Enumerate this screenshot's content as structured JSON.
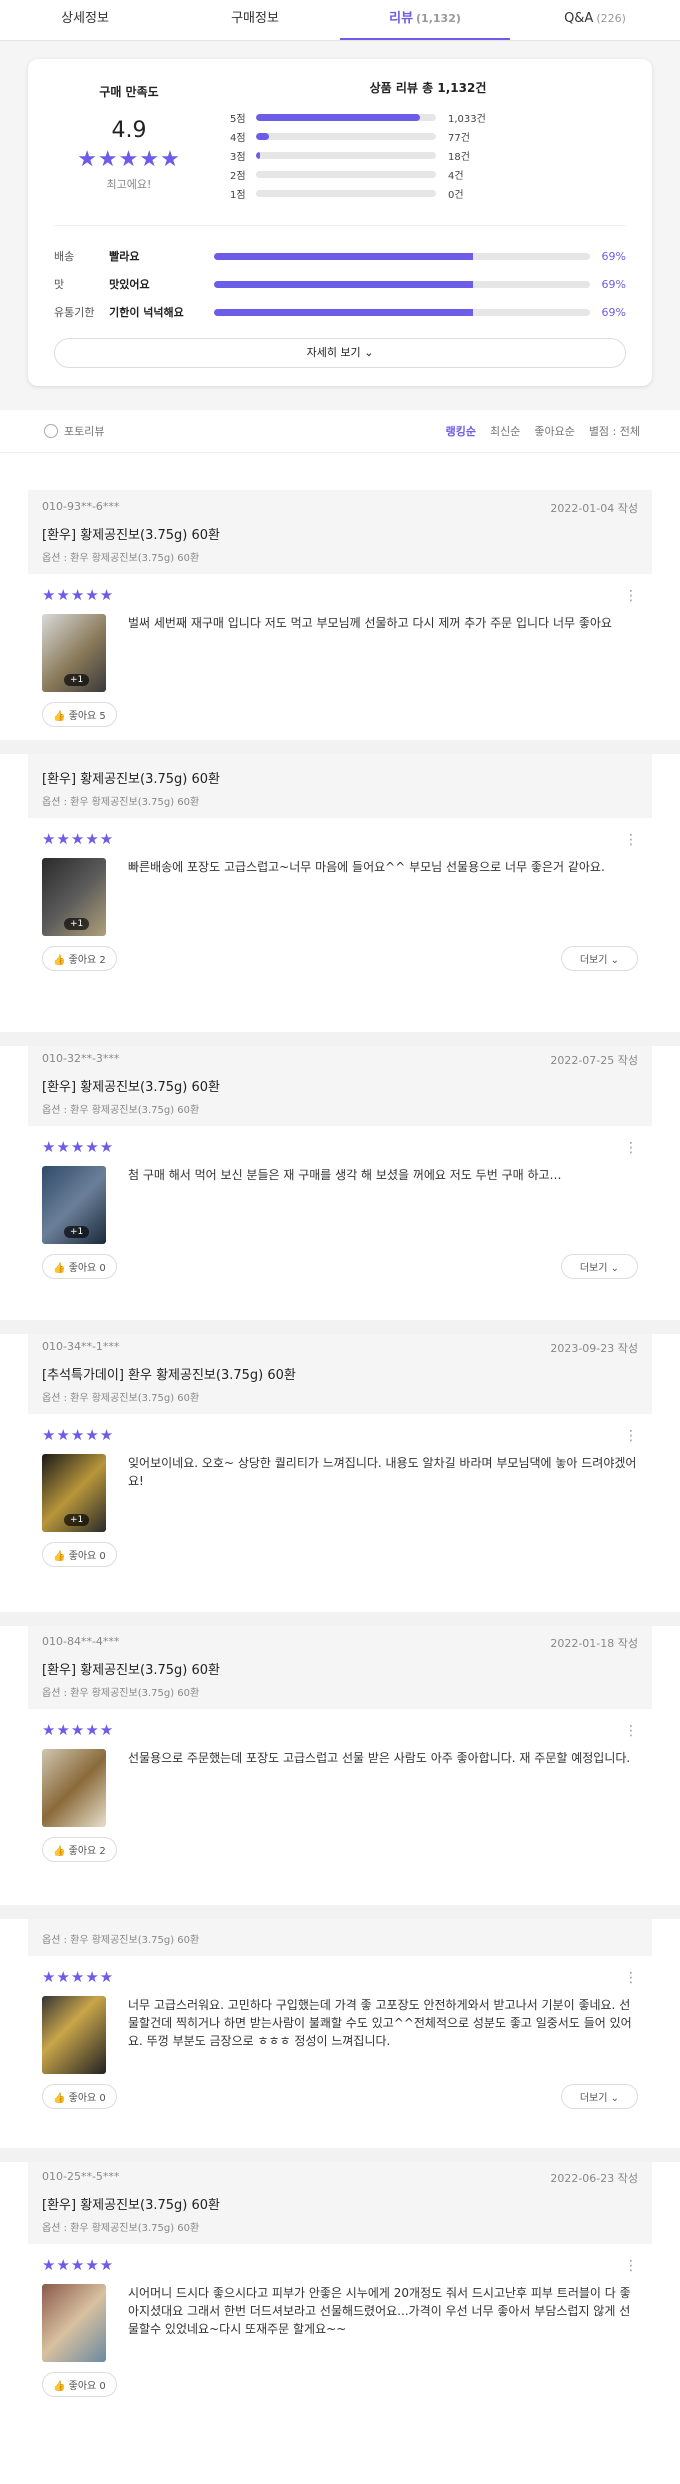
{
  "tabs": [
    {
      "label": "상세정보",
      "count": ""
    },
    {
      "label": "구매정보",
      "count": ""
    },
    {
      "label": "리뷰",
      "count": "(1,132)"
    },
    {
      "label": "Q&A",
      "count": "(226)"
    }
  ],
  "summary": {
    "sat_title": "구매 만족도",
    "score": "4.9",
    "stars": "★★★★★",
    "sat_sub": "최고에요!",
    "dist_title": "상품 리뷰 총 1,132건",
    "dist": [
      {
        "label": "5점",
        "count": "1,033건",
        "ratio": 0.91
      },
      {
        "label": "4점",
        "count": "77건",
        "ratio": 0.07
      },
      {
        "label": "3점",
        "count": "18건",
        "ratio": 0.02
      },
      {
        "label": "2점",
        "count": "4건",
        "ratio": 0.0
      },
      {
        "label": "1점",
        "count": "0건",
        "ratio": 0.0
      }
    ],
    "attrs": [
      {
        "key": "배송",
        "value": "빨라요",
        "pct": "69%",
        "ratio": 0.69
      },
      {
        "key": "맛",
        "value": "맛있어요",
        "pct": "69%",
        "ratio": 0.69
      },
      {
        "key": "유통기한",
        "value": "기한이 넉넉해요",
        "pct": "69%",
        "ratio": 0.69
      }
    ],
    "more_label": "자세히 보기"
  },
  "filter": {
    "photo_label": "포토리뷰",
    "sorts": [
      "랭킹순",
      "최신순",
      "좋아요순"
    ],
    "rating_label": "별점 : 전체"
  },
  "reviews": [
    {
      "user": "010-93**-6***",
      "date": "2022-01-04 작성",
      "title": "[환우] 황제공진보(3.75g) 60환",
      "option": "옵션 : 환우 황제공진보(3.75g) 60환",
      "stars": "★★★★★",
      "text": "벌써 세번째 재구매 입니다 저도 먹고 부모님께 선물하고 다시 제꺼 추가 주문 입니다 너무 좋아요",
      "photos": "+1",
      "like": "좋아요 5",
      "more": ""
    },
    {
      "user": "",
      "date": "",
      "title": "[환우] 황제공진보(3.75g) 60환",
      "option": "옵션 : 환우 황제공진보(3.75g) 60환",
      "stars": "★★★★★",
      "text": "빠른배송에 포장도 고급스럽고~너무 마음에 들어요^^ 부모님 선물용으로 너무 좋은거 같아요.",
      "photos": "+1",
      "like": "좋아요 2",
      "more": "더보기"
    },
    {
      "user": "010-32**-3***",
      "date": "2022-07-25 작성",
      "title": "[환우] 황제공진보(3.75g) 60환",
      "option": "옵션 : 환우 황제공진보(3.75g) 60환",
      "stars": "★★★★★",
      "text": "첨 구매 해서 먹어 보신 분들은 재 구매를 생각 해 보셨을 꺼에요 저도 두번 구매 하고…",
      "photos": "+1",
      "like": "좋아요 0",
      "more": "더보기"
    },
    {
      "user": "010-34**-1***",
      "date": "2023-09-23 작성",
      "title": "[추석특가데이] 환우 황제공진보(3.75g) 60환",
      "option": "옵션 : 환우 황제공진보(3.75g) 60환",
      "stars": "★★★★★",
      "text": "잊어보이네요. 오호~ 상당한 퀄리티가 느껴집니다. 내용도 알차길 바라며 부모님댁에 놓아 드려야겠어요!",
      "photos": "+1",
      "like": "좋아요 0",
      "more": ""
    },
    {
      "user": "010-84**-4***",
      "date": "2022-01-18 작성",
      "title": "[환우] 황제공진보(3.75g) 60환",
      "option": "옵션 : 환우 황제공진보(3.75g) 60환",
      "stars": "★★★★★",
      "text": "선물용으로 주문했는데 포장도 고급스럽고 선물 받은 사람도 아주 좋아합니다. 재 주문할 예정입니다.",
      "photos": "",
      "like": "좋아요 2",
      "more": ""
    },
    {
      "user": "",
      "date": "",
      "title": "",
      "option": "옵션 : 환우 황제공진보(3.75g) 60환",
      "stars": "★★★★★",
      "text": "너무 고급스러워요. 고민하다 구입했는데 가격 좋 고포장도 안전하게와서 받고나서 기분이 좋네요. 선물할건데 찍히거나 하면 받는사람이 불쾌할 수도 있고^^전체적으로 성분도 좋고 일중서도 들어 있어요. 뚜껑 부분도 금장으로 ㅎㅎㅎ 정성이 느껴집니다.",
      "photos": "",
      "like": "좋아요 0",
      "more": "더보기"
    },
    {
      "user": "010-25**-5***",
      "date": "2022-06-23 작성",
      "title": "[환우] 황제공진보(3.75g) 60환",
      "option": "옵션 : 환우 황제공진보(3.75g) 60환",
      "stars": "★★★★★",
      "text": "시어머니 드시다 좋으시다고 피부가 안좋은 시누에게 20개정도 줘서 드시고난후 피부 트러블이 다 좋아지셨대요 그래서 한번 더드셔보라고 선물해드렸어요...가격이 우선 너무 좋아서 부담스럽지 않게 선물할수 있었네요~다시 또재주문 할게요~~",
      "photos": "",
      "like": "좋아요 0",
      "more": ""
    }
  ],
  "colors": {
    "accent": "#6c5ce7",
    "bg": "#f5f5f5"
  }
}
